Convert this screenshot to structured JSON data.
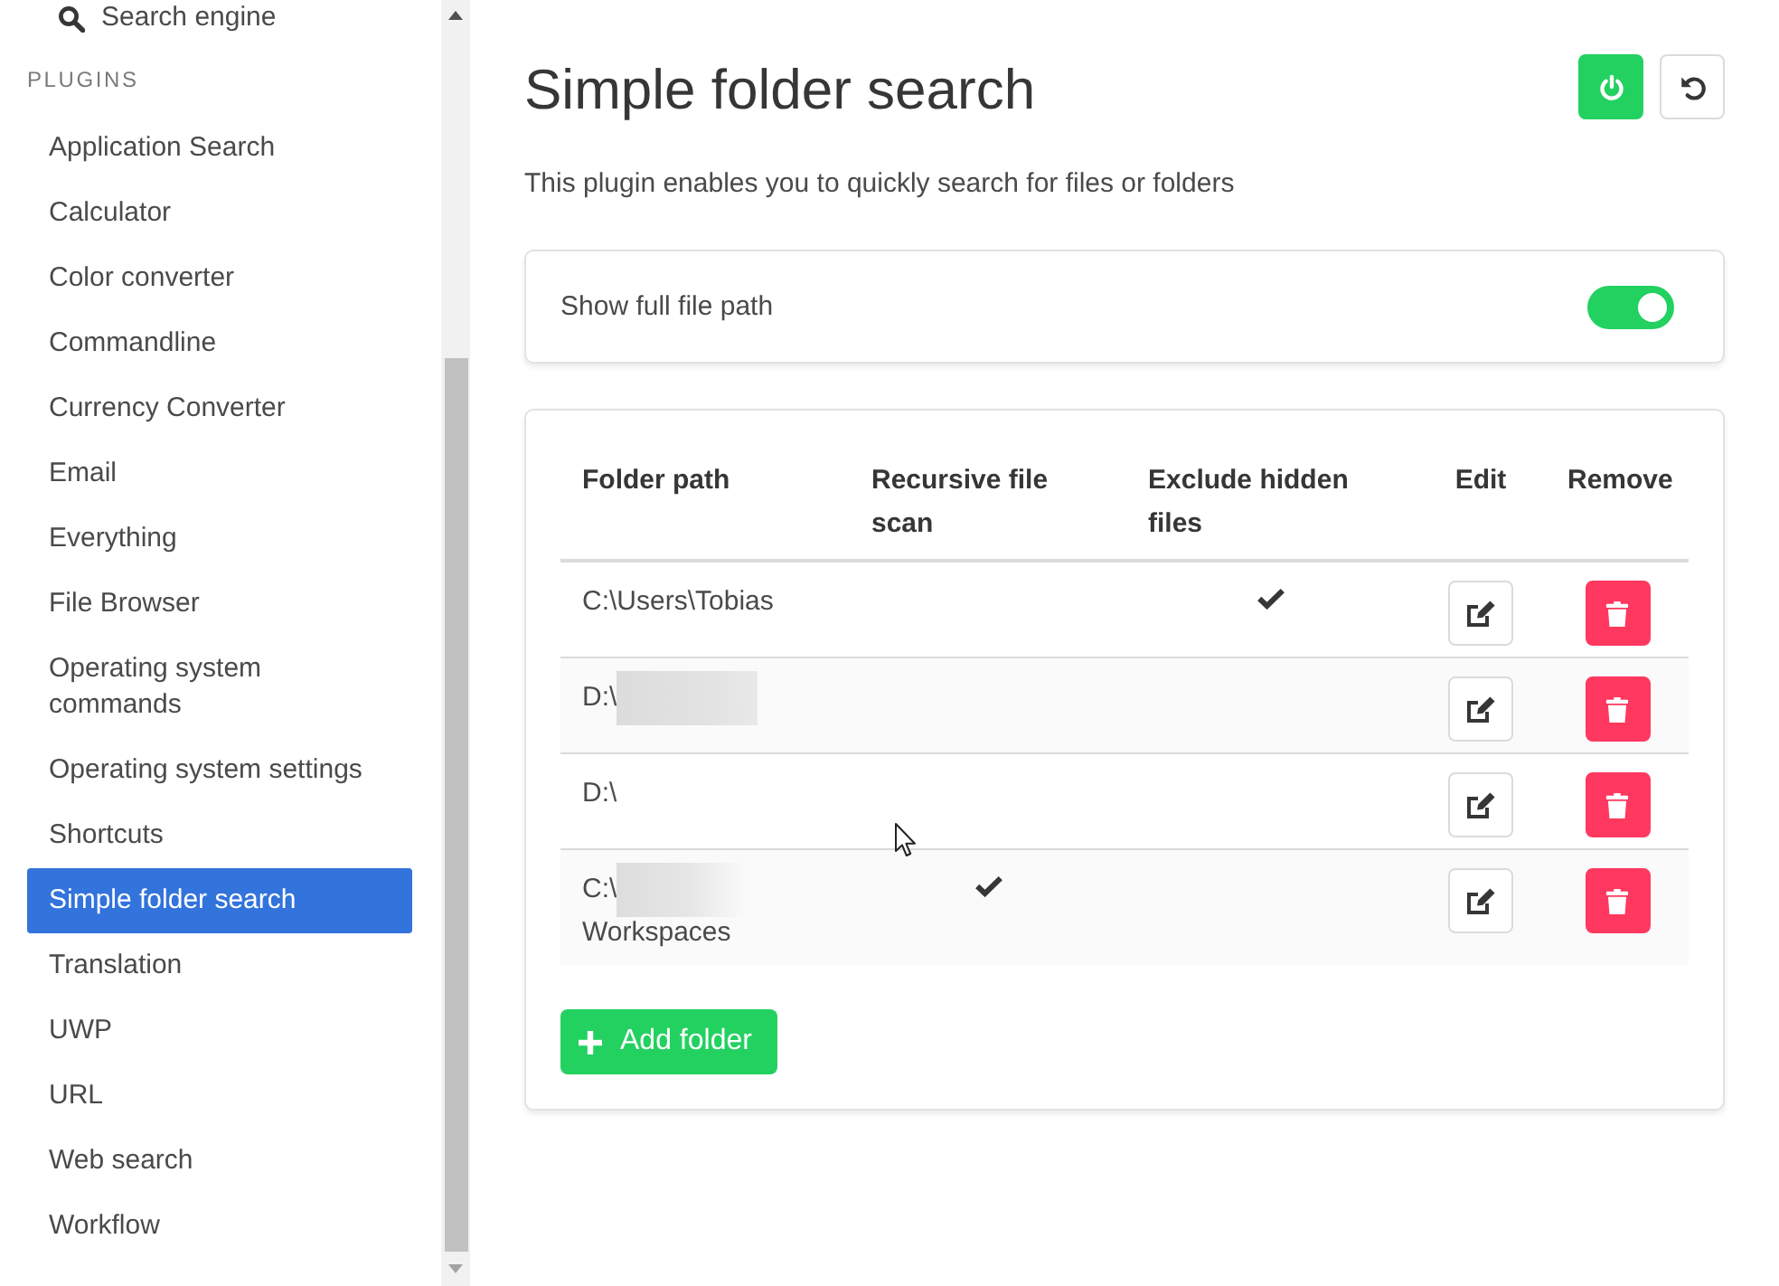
{
  "sidebar": {
    "top_item": {
      "label": "Search engine"
    },
    "section_label": "PLUGINS",
    "items": [
      {
        "label": "Application Search",
        "selected": false
      },
      {
        "label": "Calculator",
        "selected": false
      },
      {
        "label": "Color converter",
        "selected": false
      },
      {
        "label": "Commandline",
        "selected": false
      },
      {
        "label": "Currency Converter",
        "selected": false
      },
      {
        "label": "Email",
        "selected": false
      },
      {
        "label": "Everything",
        "selected": false
      },
      {
        "label": "File Browser",
        "selected": false
      },
      {
        "label": "Operating system commands",
        "selected": false
      },
      {
        "label": "Operating system settings",
        "selected": false
      },
      {
        "label": "Shortcuts",
        "selected": false
      },
      {
        "label": "Simple folder search",
        "selected": true
      },
      {
        "label": "Translation",
        "selected": false
      },
      {
        "label": "UWP",
        "selected": false
      },
      {
        "label": "URL",
        "selected": false
      },
      {
        "label": "Web search",
        "selected": false
      },
      {
        "label": "Workflow",
        "selected": false
      }
    ]
  },
  "page": {
    "title": "Simple folder search",
    "enabled": true,
    "description": "This plugin enables you to quickly search for files or folders"
  },
  "settings": [
    {
      "label": "Show full file path",
      "on": true
    }
  ],
  "folders": {
    "columns": [
      "Folder path",
      "Recursive file scan",
      "Exclude hidden files",
      "Edit",
      "Remove"
    ],
    "rows": [
      {
        "path": "C:\\Users\\Tobias",
        "redacted": false,
        "recursive": false,
        "exclude_hidden": true
      },
      {
        "path": "D:\\",
        "redacted": true,
        "recursive": false,
        "exclude_hidden": false
      },
      {
        "path": "D:\\",
        "redacted": false,
        "recursive": false,
        "exclude_hidden": false
      },
      {
        "path": "C:\\",
        "redacted": true,
        "path_end": "Workspaces",
        "recursive": true,
        "exclude_hidden": false
      }
    ],
    "add_button": "Add folder"
  }
}
